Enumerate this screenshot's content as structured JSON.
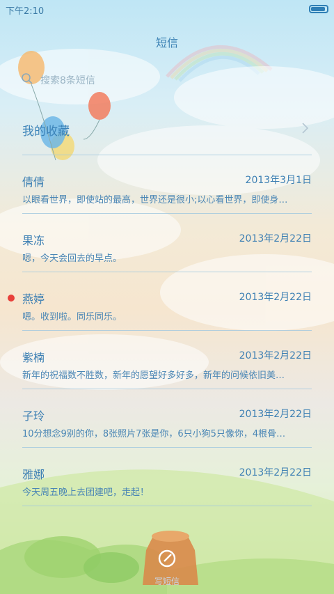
{
  "status_bar": {
    "time": "下午2:10",
    "battery_level": 0.9
  },
  "header": {
    "title": "短信"
  },
  "search": {
    "placeholder": "搜索8条短信"
  },
  "favorites": {
    "label": "我的收藏"
  },
  "messages": [
    {
      "name": "倩倩",
      "date": "2013年3月1日",
      "preview": "以眼看世界，即使站的最高，世界还是很小;以心看世界，即使身…",
      "unread": false
    },
    {
      "name": "果冻",
      "date": "2013年2月22日",
      "preview": "嗯，今天会回去的早点。",
      "unread": false
    },
    {
      "name": "燕婷",
      "date": "2013年2月22日",
      "preview": "嗯。收到啦。同乐同乐。",
      "unread": true
    },
    {
      "name": "紫楠",
      "date": "2013年2月22日",
      "preview": "新年的祝福数不胜数，新年的愿望好多好多，新年的问候依旧美…",
      "unread": false
    },
    {
      "name": "子玲",
      "date": "2013年2月22日",
      "preview": "10分想念9别的你，8张照片7张是你，6只小狗5只像你，4根骨…",
      "unread": false
    },
    {
      "name": "雅娜",
      "date": "2013年2月22日",
      "preview": "今天周五晚上去团建吧，走起！",
      "unread": false
    }
  ],
  "compose": {
    "label": "写短信"
  },
  "colors": {
    "accent": "#3c7fb3",
    "unread_dot": "#e8403a"
  }
}
